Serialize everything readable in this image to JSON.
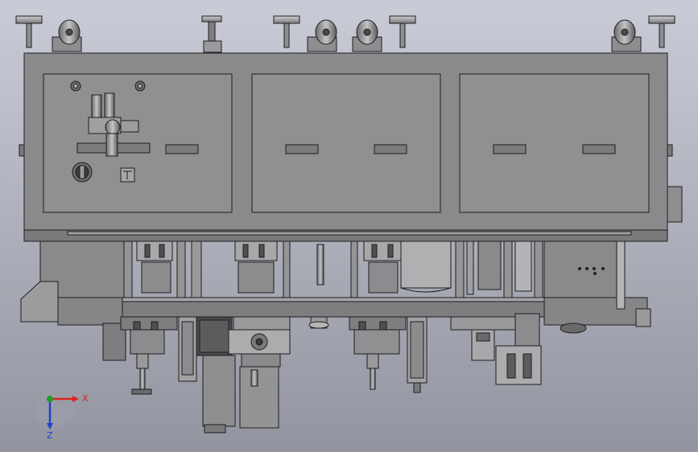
{
  "viewport": {
    "background_top": "#c9cbd6",
    "background_bottom": "#92949f"
  },
  "colors": {
    "body": "#8a8a8c",
    "panel": "#909092",
    "dark": "#5a5a5c",
    "edge": "#1e1e20",
    "light": "#b4b4b6",
    "axis_x": "#e02020",
    "axis_y": "#20a020",
    "axis_z": "#2040d0"
  },
  "triad": {
    "x_label": "X",
    "z_label": "Z"
  }
}
